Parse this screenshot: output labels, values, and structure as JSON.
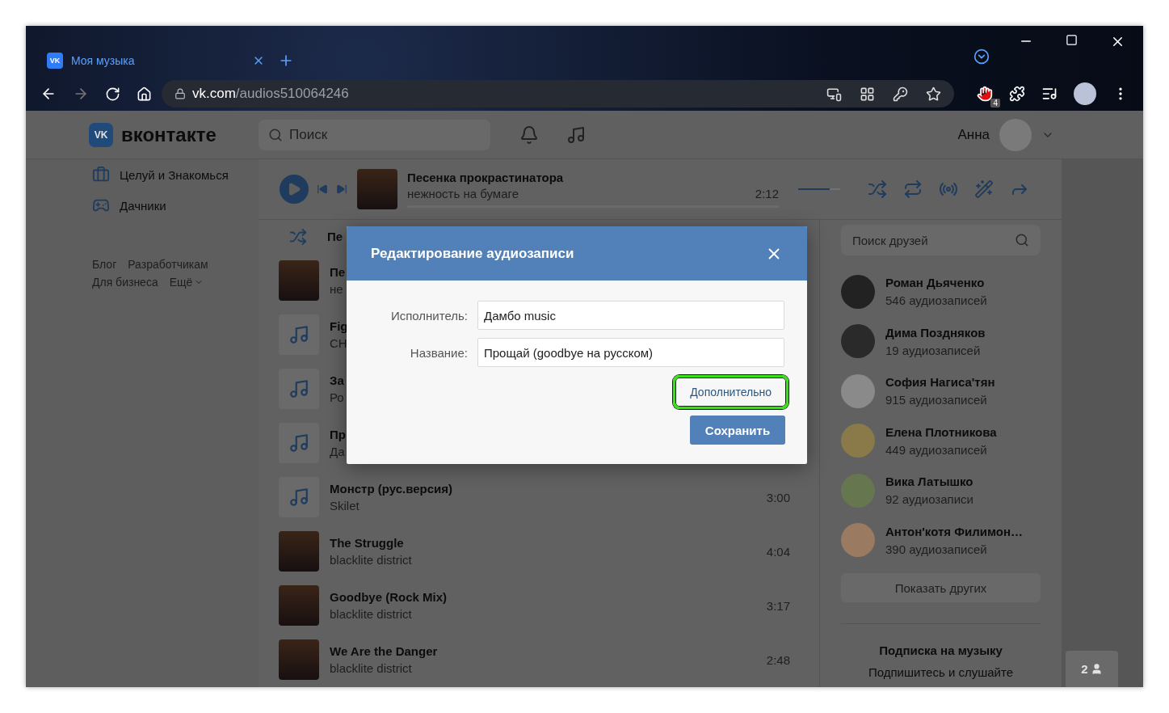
{
  "browser": {
    "tab": {
      "icon_text": "VK",
      "title": "Моя музыка",
      "selected": true
    },
    "address": {
      "host": "vk.com",
      "path": "/audios510064246"
    },
    "extension_badge": "4",
    "forward_disabled": true
  },
  "header": {
    "logo_mark": "VK",
    "logo_text": "вконтакте",
    "search_placeholder": "Поиск",
    "user_name": "Анна"
  },
  "sidebar": {
    "items": [
      {
        "kind": "briefcase",
        "label": "Целуй и Знакомься"
      },
      {
        "kind": "gamepad",
        "label": "Дачники"
      }
    ],
    "footer_links": [
      "Блог",
      "Разработчикам",
      "Для бизнеса",
      "Ещё"
    ]
  },
  "player": {
    "title": "Песенка прокрастинатора",
    "artist": "нежность на бумаге",
    "time": "2:12",
    "volume": {
      "level": 0.75
    }
  },
  "shuffle_row": {
    "label": "Пе"
  },
  "tracks": [
    {
      "kind": "photo",
      "title": "Пе",
      "artist": "не"
    },
    {
      "kind": "note",
      "title": "Fig",
      "artist": "CH"
    },
    {
      "kind": "note",
      "title": "За",
      "artist": "Ро"
    },
    {
      "kind": "note",
      "title": "Пр",
      "artist": "Да"
    },
    {
      "kind": "note",
      "title": "Монстр (рус.версия)",
      "artist": "Skilet",
      "duration": "3:00"
    },
    {
      "kind": "photo",
      "title": "The Struggle",
      "artist": "blacklite district",
      "duration": "4:04"
    },
    {
      "kind": "photo",
      "title": "Goodbye (Rock Mix)",
      "artist": "blacklite district",
      "duration": "3:17"
    },
    {
      "kind": "photo",
      "title": "We Are the Danger",
      "artist": "blacklite district",
      "duration": "2:48"
    }
  ],
  "friends": {
    "search_placeholder": "Поиск друзей",
    "items": [
      {
        "name": "Роман Дьяченко",
        "count": "546 аудиозаписей"
      },
      {
        "name": "Дима Поздняков",
        "count": "19 аудиозаписей"
      },
      {
        "name": "София Нагиса'тян",
        "count": "915 аудиозаписей"
      },
      {
        "name": "Елена Плотникова",
        "count": "449 аудиозаписей"
      },
      {
        "name": "Вика Латышко",
        "count": "92 аудиозаписи"
      },
      {
        "name": "Антон'котя Филимон…",
        "count": "390 аудиозаписей"
      }
    ],
    "show_more": "Показать других"
  },
  "subscription": {
    "title": "Подписка на музыку",
    "text": "Подпишитесь и слушайте"
  },
  "online_badge": "2",
  "dialog": {
    "title": "Редактирование аудиозаписи",
    "fields": [
      {
        "label": "Исполнитель:",
        "value": "Дамбо music"
      },
      {
        "label": "Название:",
        "value": "Прощай (goodbye на русском)"
      }
    ],
    "more_link": {
      "label": "Дополнительно",
      "highlighted": true
    },
    "save": "Сохранить"
  }
}
